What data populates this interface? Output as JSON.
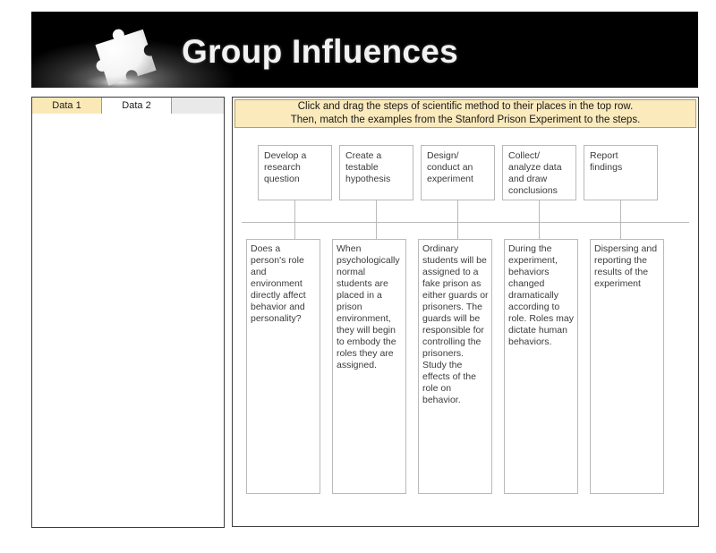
{
  "header": {
    "title": "Group Influences",
    "icon": "puzzle-piece-icon",
    "background_color": "#000000",
    "text_color": "#f2f2f2"
  },
  "left_panel": {
    "tabs": [
      {
        "label": "Data 1",
        "active": true,
        "background_color": "#fae9b7"
      },
      {
        "label": "Data 2",
        "active": false,
        "background_color": "#ffffff"
      }
    ]
  },
  "right_panel": {
    "instructions": {
      "line1": "Click and drag the steps of scientific method to their places in the top row.",
      "line2": "Then, match the examples from the Stanford Prison Experiment to the steps.",
      "background_color": "#faeabc",
      "border_color": "#b4a05f"
    },
    "steps": [
      {
        "label": "Develop a research question"
      },
      {
        "label": "Create a testable hypothesis"
      },
      {
        "label": "Design/ conduct an experiment"
      },
      {
        "label": "Collect/ analyze data and draw conclusions"
      },
      {
        "label": "Report findings"
      }
    ],
    "examples": [
      {
        "label": "Does a person's role and environment directly affect behavior and personality?"
      },
      {
        "label": "When psychologically normal students are placed in a prison environment, they will begin to embody the roles they are assigned."
      },
      {
        "label": "Ordinary students will be assigned to a fake prison as either guards or prisoners. The guards will be responsible for controlling the prisoners. Study the effects of the role on behavior."
      },
      {
        "label": "During the experiment, behaviors changed dramatically according to role. Roles may dictate human behaviors."
      },
      {
        "label": "Dispersing and reporting the results of the experiment"
      }
    ]
  }
}
